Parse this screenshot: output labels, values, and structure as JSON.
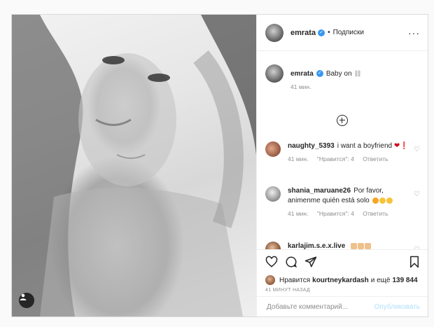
{
  "post": {
    "author": "emrata",
    "follow_state": "Подписки",
    "caption_author": "emrata",
    "caption_text": "Baby on",
    "caption_time": "41 мин."
  },
  "comments": [
    {
      "user": "naughty_5393",
      "text": "i want a boyfriend",
      "time": "41 мин.",
      "likes": "\"Нравится\": 4",
      "reply": "Ответить"
    },
    {
      "user": "shania_maruane26",
      "text": "Por favor, animenme quién está solo",
      "time": "41 мин.",
      "likes": "\"Нравится\": 4",
      "reply": "Ответить"
    },
    {
      "user": "karlajim.s.e.x.live",
      "text": "",
      "time": "",
      "likes": "",
      "reply": ""
    }
  ],
  "likes_line": {
    "prefix": "Нравится",
    "user": "kourtneykardash",
    "suffix": "и ещё",
    "count": "139 844"
  },
  "post_time": "41 МИНУТ НАЗАД",
  "comment_box": {
    "placeholder": "Добавьте комментарий...",
    "publish_label": "Опубликовать"
  },
  "icons": {
    "verified": "verified-badge-icon",
    "more": "more-dots-icon",
    "like": "heart-icon",
    "comment": "comment-bubble-icon",
    "share": "paper-plane-icon",
    "save": "bookmark-icon",
    "load_more": "plus-circle-icon",
    "tag": "user-tag-icon"
  },
  "colors": {
    "accent": "#3897f0",
    "publish_disabled": "#b2dffc",
    "muted": "#8e8e8e"
  }
}
